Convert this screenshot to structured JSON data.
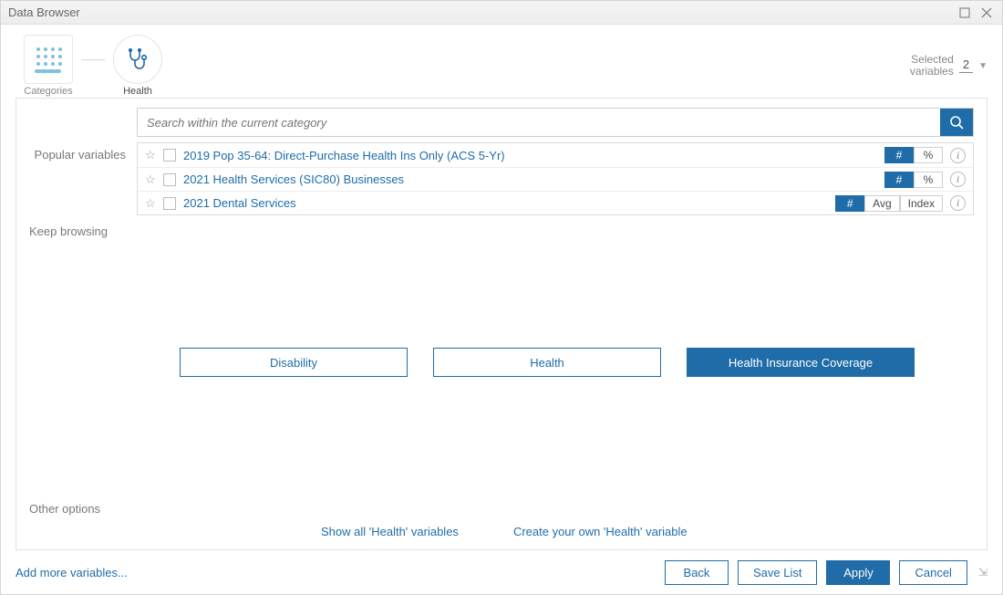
{
  "window": {
    "title": "Data Browser"
  },
  "breadcrumbs": {
    "categories_label": "Categories",
    "health_label": "Health"
  },
  "selected_variables": {
    "label_line1": "Selected",
    "label_line2": "variables",
    "count": "2"
  },
  "search": {
    "placeholder": "Search within the current category"
  },
  "sections": {
    "popular": "Popular variables",
    "keep": "Keep browsing",
    "other": "Other options"
  },
  "popular_variables": [
    {
      "name": "2019 Pop 35-64: Direct-Purchase Health Ins Only (ACS 5-Yr)",
      "chips": [
        {
          "label": "#",
          "active": true
        },
        {
          "label": "%",
          "active": false
        }
      ]
    },
    {
      "name": "2021 Health Services (SIC80) Businesses",
      "chips": [
        {
          "label": "#",
          "active": true
        },
        {
          "label": "%",
          "active": false
        }
      ]
    },
    {
      "name": "2021 Dental Services",
      "chips": [
        {
          "label": "#",
          "active": true
        },
        {
          "label": "Avg",
          "active": false
        },
        {
          "label": "Index",
          "active": false
        }
      ]
    }
  ],
  "categories": [
    {
      "label": "Disability",
      "active": false
    },
    {
      "label": "Health",
      "active": false
    },
    {
      "label": "Health Insurance Coverage",
      "active": true
    }
  ],
  "other_links": {
    "show_all": "Show all 'Health' variables",
    "create": "Create your own 'Health' variable"
  },
  "footer": {
    "add_more": "Add more variables...",
    "back": "Back",
    "save_list": "Save List",
    "apply": "Apply",
    "cancel": "Cancel"
  }
}
